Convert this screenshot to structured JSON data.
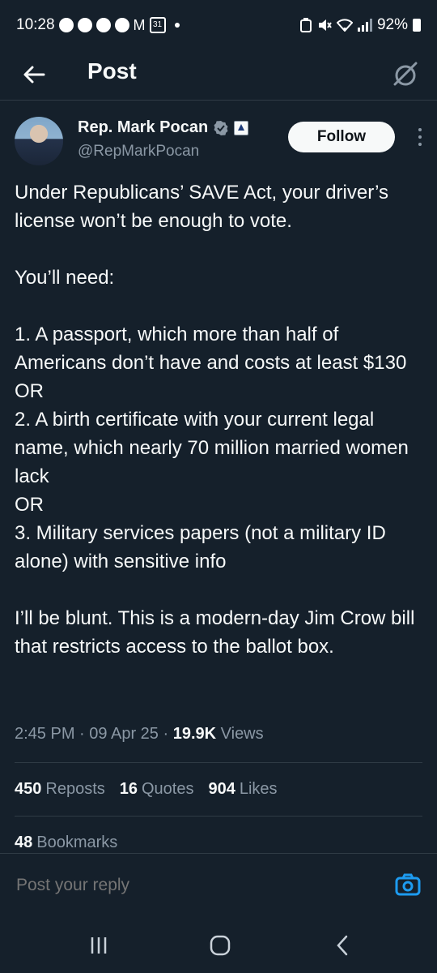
{
  "status_bar": {
    "time": "10:28",
    "battery": "92%",
    "calendar_day": "31",
    "icons": [
      "messenger-icon",
      "messenger-icon",
      "messenger-icon",
      "gmail-icon",
      "calendar-icon",
      "dot",
      "battery-saver-icon",
      "mute-icon",
      "wifi-icon",
      "signal-icon",
      "battery-icon"
    ]
  },
  "header": {
    "title": "Post",
    "back_icon": "back-arrow-icon",
    "grok_icon": "grok-icon"
  },
  "author": {
    "name": "Rep. Mark Pocan",
    "handle": "@RepMarkPocan",
    "follow_label": "Follow",
    "verified_icon": "verified-badge-icon",
    "affiliation_icon": "government-affiliation-icon"
  },
  "post": {
    "text": "Under Republicans’ SAVE Act, your driver’s license won’t be enough to vote.\n\nYou’ll need:\n\n1. A passport, which more than half of Americans don’t have and costs at least $130\nOR\n2. A birth certificate with your current legal name, which nearly 70 million married women lack\nOR\n3. Military services papers (not a military ID alone) with sensitive info\n\nI’ll be blunt. This is a modern-day Jim Crow bill that restricts access to the ballot box.",
    "time": "2:45 PM",
    "date": "09 Apr 25",
    "views_count": "19.9K",
    "views_label": "Views",
    "separator": "·"
  },
  "stats": {
    "reposts_count": "450",
    "reposts_label": "Reposts",
    "quotes_count": "16",
    "quotes_label": "Quotes",
    "likes_count": "904",
    "likes_label": "Likes",
    "bookmarks_count": "48",
    "bookmarks_label": "Bookmarks"
  },
  "reply": {
    "placeholder": "Post your reply",
    "camera_icon": "camera-icon"
  },
  "colors": {
    "background": "#15202b",
    "text": "#f7f9f9",
    "secondary": "#8b98a5",
    "accent": "#1d9bf0"
  }
}
